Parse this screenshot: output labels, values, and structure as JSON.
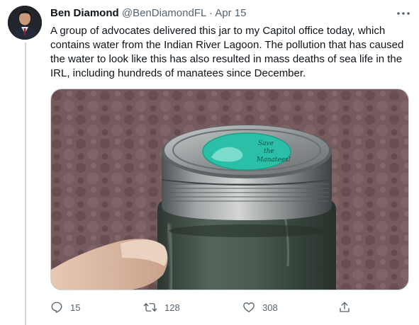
{
  "tweet": {
    "author_name": "Ben Diamond",
    "handle": "@BenDiamondFL",
    "separator": "·",
    "date": "Apr 15",
    "more_icon": "more-horizontal-icon",
    "text": "A group of advocates delivered this jar to my Capitol office today, which contains water from the Indian River Lagoon. The pollution that has caused the water to look like this has also resulted in mass deaths of sea life in the IRL, including hundreds of manatees since December.",
    "media": {
      "lid_text_line1": "Save",
      "lid_text_line2": "the",
      "lid_text_line3": "Manatees!"
    },
    "actions": {
      "reply_count": "15",
      "retweet_count": "128",
      "like_count": "308",
      "reply_icon": "reply-icon",
      "retweet_icon": "retweet-icon",
      "like_icon": "heart-icon",
      "share_icon": "share-icon"
    }
  }
}
